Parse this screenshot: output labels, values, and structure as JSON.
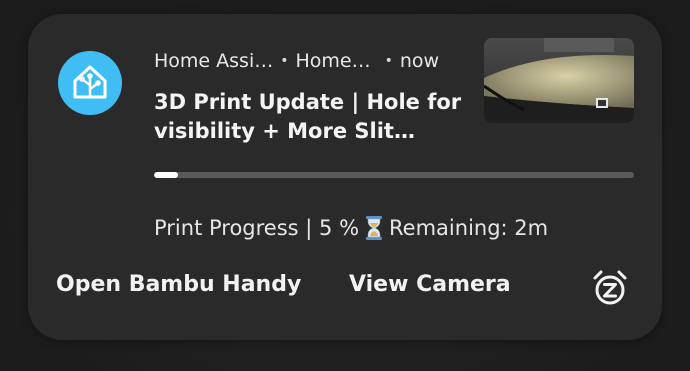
{
  "notification": {
    "app_name": "Home Assi…",
    "sub_source": "Home…",
    "time": "now",
    "separator": "•",
    "title": "3D Print Update | Hole for visibility + More Slit…",
    "progress_percent": 5,
    "body_prefix": "Print Progress | 5 %",
    "body_suffix": "Remaining: 2m",
    "icons": {
      "app": "home-assistant-icon",
      "status": "hourglass-icon",
      "snooze": "snooze-alarm-icon"
    },
    "accent_color": "#41bdf5"
  },
  "actions": {
    "open_label": "Open Bambu Handy",
    "camera_label": "View Camera"
  }
}
